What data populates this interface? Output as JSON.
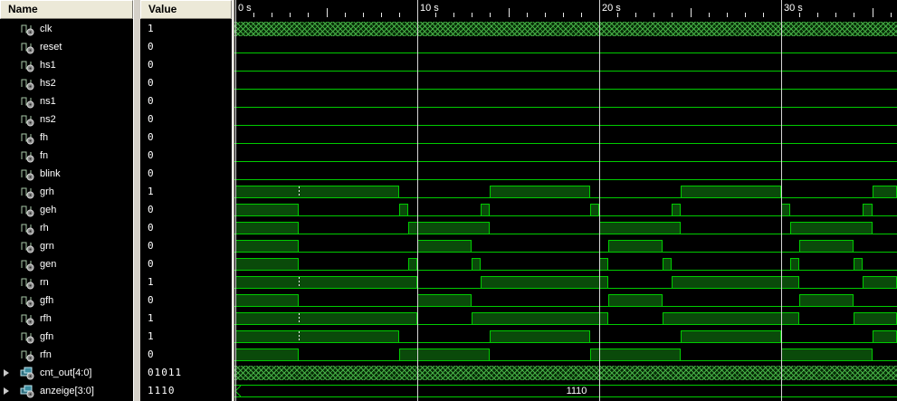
{
  "panels": {
    "name_header": "Name",
    "value_header": "Value"
  },
  "timeline": {
    "markers": [
      {
        "t": 0,
        "label": "0 s"
      },
      {
        "t": 10,
        "label": "10 s"
      },
      {
        "t": 20,
        "label": "20 s"
      },
      {
        "t": 30,
        "label": "30 s"
      }
    ],
    "t_end": 36.4
  },
  "cursor": {
    "t": 3.5,
    "rows": [
      "grh",
      "rn",
      "rfh",
      "gfn"
    ]
  },
  "colors": {
    "wave_line": "#00cc00",
    "wave_fill": "#0a4a0a",
    "hatch_green": "#46ae46",
    "grid": "#d6d6d6",
    "panel_bg": "#000000",
    "panel_text": "#ffffff",
    "header_bg": "#ece9d8",
    "header_text": "#000000"
  },
  "signals": [
    {
      "name": "clk",
      "value": "1",
      "kind": "clock"
    },
    {
      "name": "reset",
      "value": "0",
      "kind": "bit",
      "high": []
    },
    {
      "name": "hs1",
      "value": "0",
      "kind": "bit",
      "high": []
    },
    {
      "name": "hs2",
      "value": "0",
      "kind": "bit",
      "high": []
    },
    {
      "name": "ns1",
      "value": "0",
      "kind": "bit",
      "high": []
    },
    {
      "name": "ns2",
      "value": "0",
      "kind": "bit",
      "high": []
    },
    {
      "name": "fh",
      "value": "0",
      "kind": "bit",
      "high": []
    },
    {
      "name": "fn",
      "value": "0",
      "kind": "bit",
      "high": []
    },
    {
      "name": "blink",
      "value": "0",
      "kind": "bit",
      "high": []
    },
    {
      "name": "grh",
      "value": "1",
      "kind": "bit",
      "high": [
        [
          0,
          9
        ],
        [
          14,
          19.5
        ],
        [
          24.5,
          30
        ],
        [
          35,
          36.4
        ]
      ]
    },
    {
      "name": "geh",
      "value": "0",
      "kind": "bit",
      "high": [
        [
          0,
          3.5
        ],
        [
          9,
          9.5
        ],
        [
          13.5,
          14
        ],
        [
          19.5,
          20
        ],
        [
          24,
          24.5
        ],
        [
          30,
          30.5
        ],
        [
          34.5,
          35
        ]
      ]
    },
    {
      "name": "rh",
      "value": "0",
      "kind": "bit",
      "high": [
        [
          0,
          3.5
        ],
        [
          9.5,
          14
        ],
        [
          20,
          24.5
        ],
        [
          30.5,
          35
        ]
      ]
    },
    {
      "name": "grn",
      "value": "0",
      "kind": "bit",
      "high": [
        [
          0,
          3.5
        ],
        [
          10,
          13
        ],
        [
          20.5,
          23.5
        ],
        [
          31,
          34
        ]
      ]
    },
    {
      "name": "gen",
      "value": "0",
      "kind": "bit",
      "high": [
        [
          0,
          3.5
        ],
        [
          9.5,
          10
        ],
        [
          13,
          13.5
        ],
        [
          20,
          20.5
        ],
        [
          23.5,
          24
        ],
        [
          30.5,
          31
        ],
        [
          34,
          34.5
        ]
      ]
    },
    {
      "name": "rn",
      "value": "1",
      "kind": "bit",
      "high": [
        [
          0,
          10
        ],
        [
          13.5,
          20.5
        ],
        [
          24,
          31
        ],
        [
          34.5,
          36.4
        ]
      ]
    },
    {
      "name": "gfh",
      "value": "0",
      "kind": "bit",
      "high": [
        [
          0,
          3.5
        ],
        [
          10,
          13
        ],
        [
          20.5,
          23.5
        ],
        [
          31,
          34
        ]
      ]
    },
    {
      "name": "rfh",
      "value": "1",
      "kind": "bit",
      "high": [
        [
          0,
          10
        ],
        [
          13,
          20.5
        ],
        [
          23.5,
          31
        ],
        [
          34,
          36.4
        ]
      ]
    },
    {
      "name": "gfn",
      "value": "1",
      "kind": "bit",
      "high": [
        [
          0,
          9
        ],
        [
          14,
          19.5
        ],
        [
          24.5,
          30
        ],
        [
          35,
          36.4
        ]
      ]
    },
    {
      "name": "rfn",
      "value": "0",
      "kind": "bit",
      "high": [
        [
          0,
          3.5
        ],
        [
          9,
          14
        ],
        [
          19.5,
          24.5
        ],
        [
          30,
          35
        ]
      ]
    },
    {
      "name": "cnt_out[4:0]",
      "value": "01011",
      "kind": "busclock",
      "expandable": true
    },
    {
      "name": "anzeige[3:0]",
      "value": "1110",
      "kind": "bus",
      "bus_label": "1110",
      "expandable": true
    }
  ]
}
